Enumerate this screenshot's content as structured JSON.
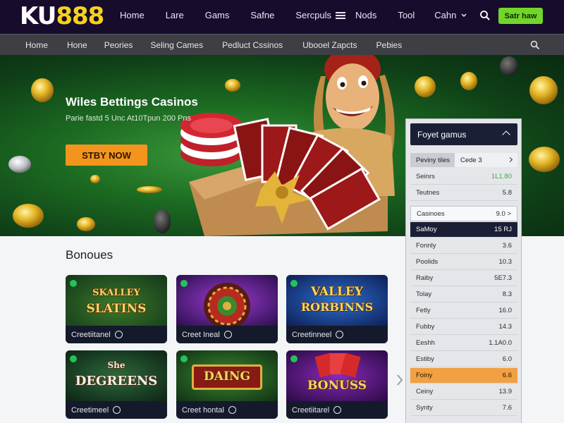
{
  "brand": {
    "logo_prefix": "KU",
    "logo_number": "888"
  },
  "topnav": {
    "items": [
      "Home",
      "Lare",
      "Gams",
      "Safne",
      "Sercpuls"
    ],
    "right_items": [
      "Nods",
      "Tool",
      "Cahn"
    ],
    "cta": "Satr haw"
  },
  "subnav": {
    "items": [
      "Home",
      "Hone",
      "Peories",
      "Seling Cames",
      "Pedluct Cssinos",
      "Ubooel Zapcts",
      "Pebies"
    ]
  },
  "hero": {
    "title": "Wiles Bettings Casinos",
    "subtitle": "Parie fastd 5 Unc At10Tpun 200 Pns",
    "button": "STBY NOW"
  },
  "bonuses": {
    "title": "Bonoues",
    "cards": [
      {
        "art_line1": "SKALLEY",
        "art_line2": "SLATINS",
        "caption": "Creetiitanel"
      },
      {
        "art_line1": "",
        "art_line2": "",
        "caption": "Creet Ineal"
      },
      {
        "art_line1": "VALLEY",
        "art_line2": "RORBINNS",
        "caption": "Creetinneel"
      },
      {
        "art_line1": "She",
        "art_line2": "DEGREENS",
        "caption": "Creetimeel"
      },
      {
        "art_line1": "",
        "art_line2": "DAING",
        "caption": "Creet hontal"
      },
      {
        "art_line1": "",
        "art_line2": "BONUSS",
        "caption": "Creetiitarel"
      }
    ]
  },
  "panel": {
    "title": "Foyet gamus",
    "tabs": [
      "Peviny tiles",
      "Cede 3"
    ],
    "rows": [
      {
        "label": "Seinrs",
        "value": "1L1.80"
      },
      {
        "label": "Teutnes",
        "value": "5.8"
      },
      {
        "label": "Casinoes",
        "value": "9.0 >"
      },
      {
        "label": "SaMoy",
        "value": "15 RJ"
      },
      {
        "label": "Fonnly",
        "value": "3.6"
      },
      {
        "label": "Poolids",
        "value": "10.3"
      },
      {
        "label": "Raiby",
        "value": "5E7.3"
      },
      {
        "label": "Tolay",
        "value": "8.3"
      },
      {
        "label": "Fetly",
        "value": "16.0"
      },
      {
        "label": "Fubby",
        "value": "14.3"
      },
      {
        "label": "Eeshh",
        "value": "1.1A0.0"
      },
      {
        "label": "Estiby",
        "value": "6.0"
      },
      {
        "label": "Foiny",
        "value": "6.6"
      },
      {
        "label": "Ceiny",
        "value": "13.9"
      },
      {
        "label": "Synty",
        "value": "7.6"
      }
    ]
  },
  "colors": {
    "topbar": "#170c2c",
    "cta_green": "#72d629",
    "hero_button": "#f3941d",
    "panel_header": "#1b1f36",
    "highlight_orange": "#f1a042"
  }
}
